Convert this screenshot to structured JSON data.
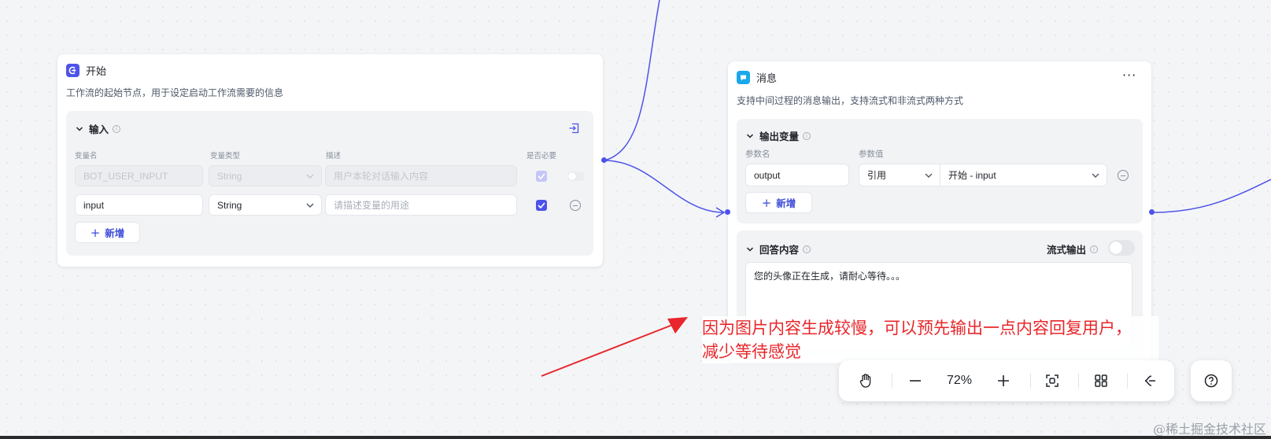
{
  "start_node": {
    "title": "开始",
    "description": "工作流的起始节点，用于设定启动工作流需要的信息",
    "input_section": {
      "title": "输入",
      "columns": [
        "变量名",
        "变量类型",
        "描述",
        "是否必要"
      ],
      "rows": [
        {
          "name": "BOT_USER_INPUT",
          "type": "String",
          "desc_placeholder": "用户本轮对话输入内容",
          "required": true,
          "disabled": true
        },
        {
          "name": "input",
          "type": "String",
          "desc_placeholder": "请描述变量的用途",
          "required": true,
          "disabled": false
        }
      ],
      "add_label": "新增"
    }
  },
  "message_node": {
    "title": "消息",
    "more": "···",
    "description": "支持中间过程的消息输出，支持流式和非流式两种方式",
    "output_section": {
      "title": "输出变量",
      "columns": [
        "参数名",
        "参数值"
      ],
      "param_name": "output",
      "param_type": "引用",
      "param_value": "开始 - input",
      "add_label": "新增"
    },
    "answer_section": {
      "title": "回答内容",
      "stream_label": "流式输出",
      "stream_enabled": false,
      "content": "您的头像正在生成，请耐心等待。。。"
    }
  },
  "annotation": {
    "line1": "因为图片内容生成较慢，可以预先输出一点内容回复用户，",
    "line2": "减少等待感觉"
  },
  "toolbar": {
    "zoom": "72%",
    "icons": [
      "hand-icon",
      "zoom-out-icon",
      "zoom-in-icon",
      "fit-view-icon",
      "layout-icon",
      "collapse-icon"
    ]
  },
  "help_icon": "help-icon",
  "watermark": "@稀土掘金技术社区",
  "colors": {
    "accent": "#4d53e8",
    "annotation": "#e8262b",
    "message_icon": "#1aa7ec"
  }
}
